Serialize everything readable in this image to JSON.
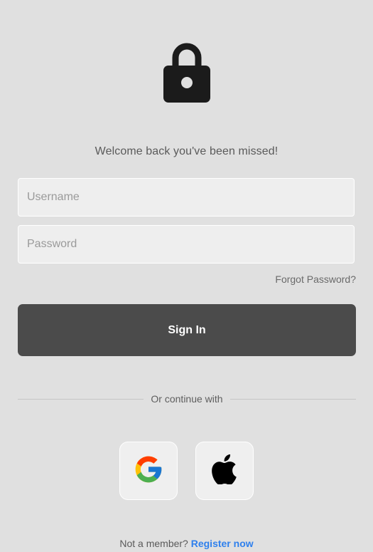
{
  "header": {
    "icon": "lock-icon",
    "welcome_text": "Welcome back you've been missed!"
  },
  "form": {
    "username_placeholder": "Username",
    "password_placeholder": "Password",
    "forgot_password_label": "Forgot Password?",
    "sign_in_label": "Sign In"
  },
  "divider": {
    "text": "Or continue with"
  },
  "social": {
    "google_icon": "google-icon",
    "apple_icon": "apple-icon"
  },
  "footer": {
    "prompt_text": "Not a member?",
    "register_label": "Register now"
  },
  "colors": {
    "background": "#e0e0e0",
    "button": "#4b4b4b",
    "link": "#2f80ed"
  }
}
